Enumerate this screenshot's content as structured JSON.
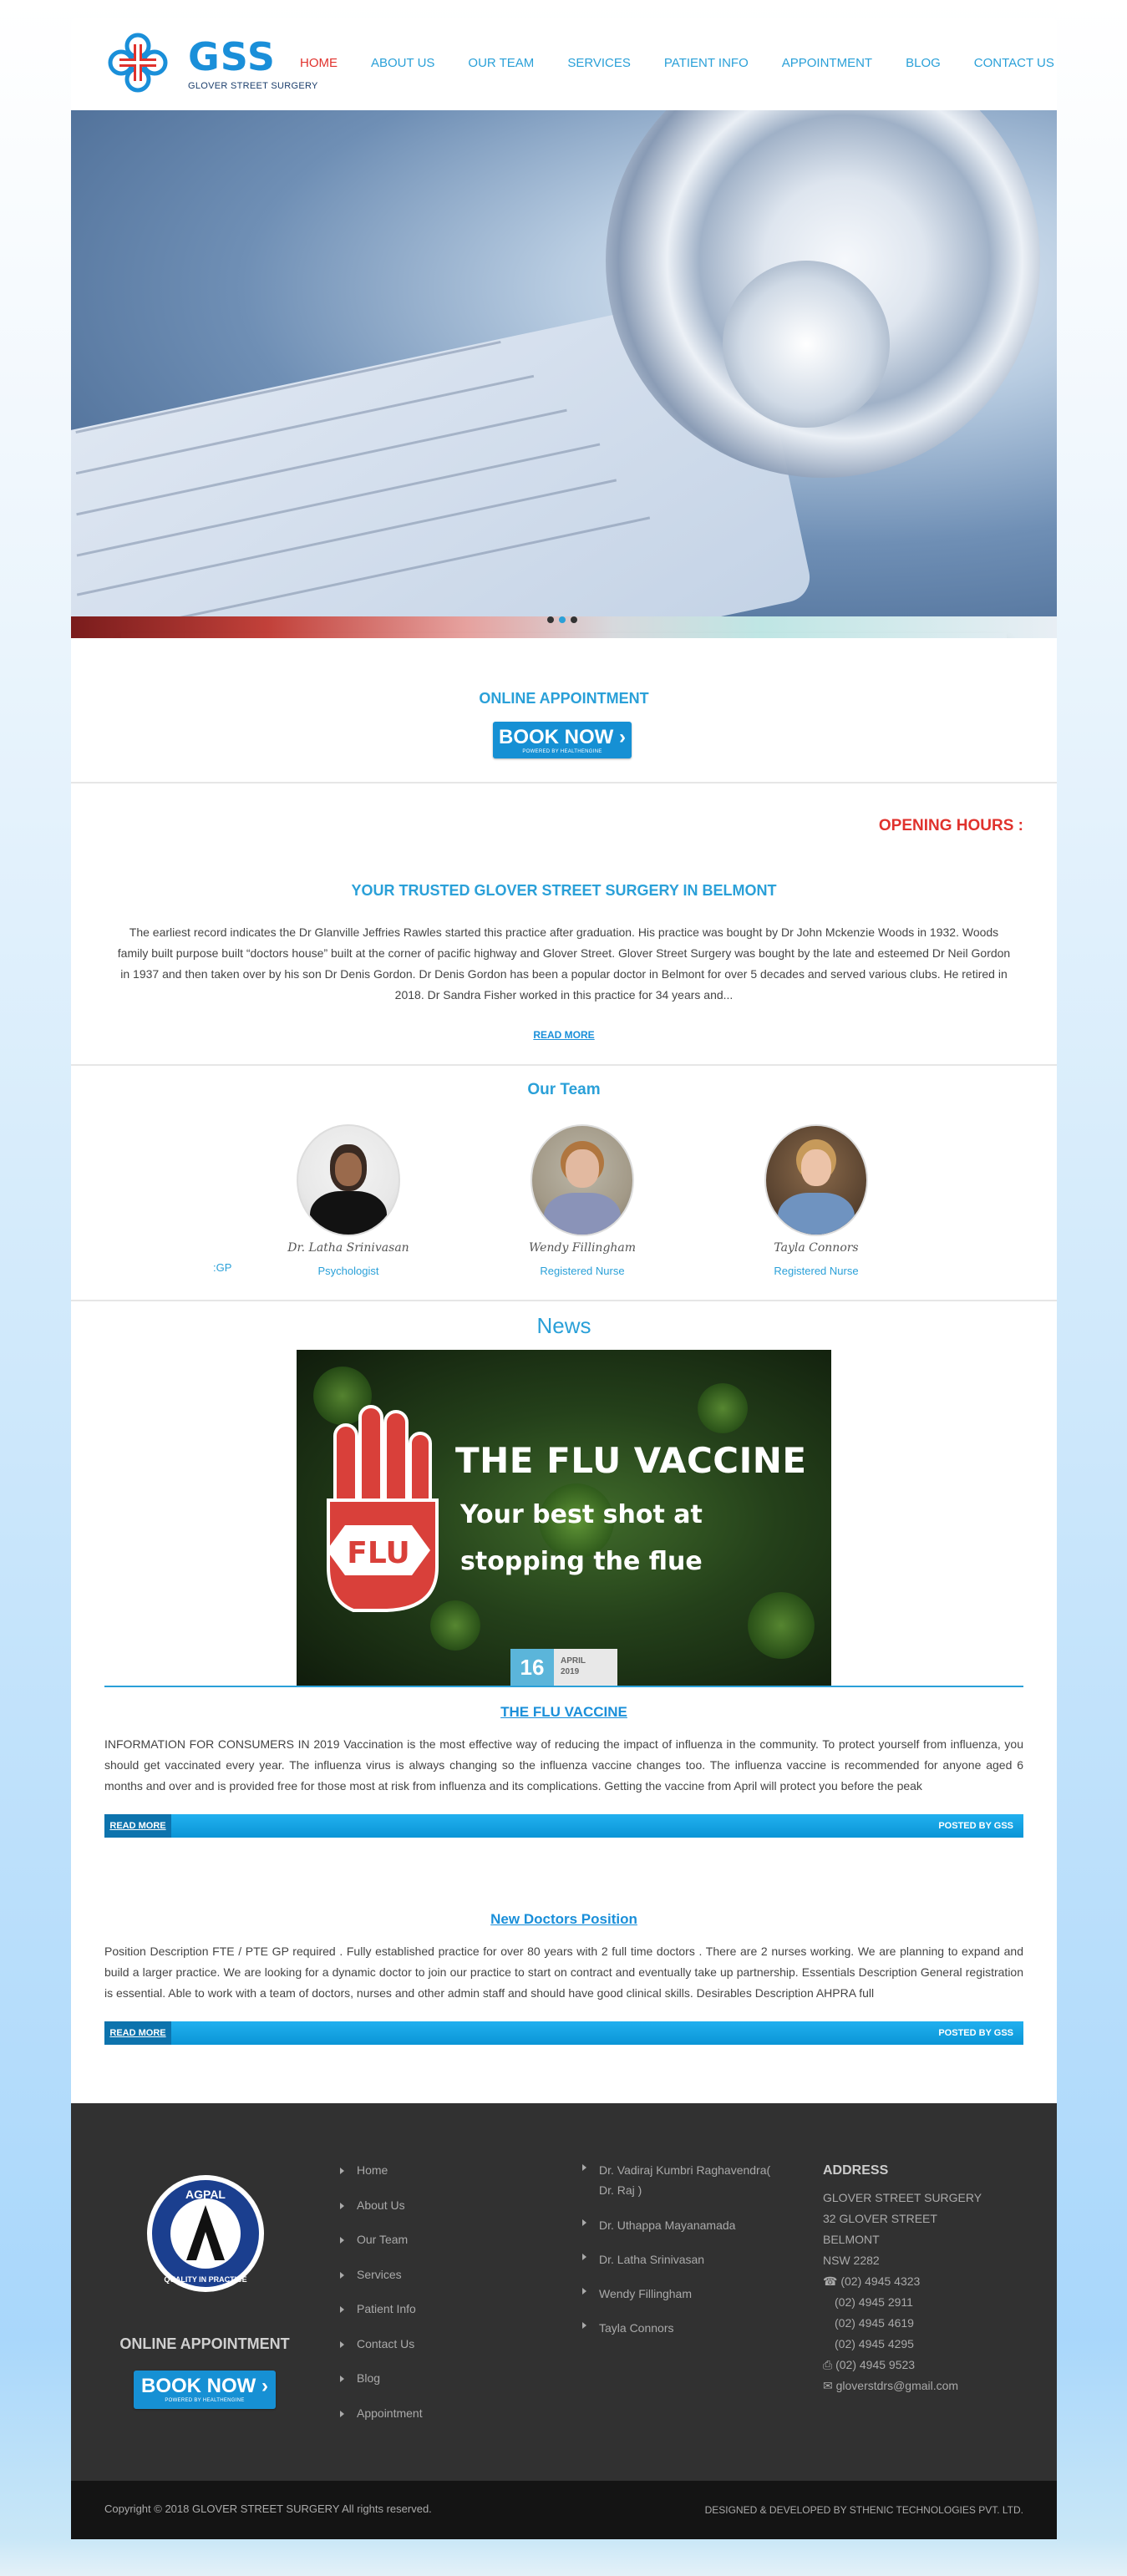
{
  "brand": {
    "logo_text": "GSS",
    "logo_subtitle": "GLOVER STREET SURGERY"
  },
  "nav": [
    {
      "label": "HOME",
      "active": true
    },
    {
      "label": "ABOUT US"
    },
    {
      "label": "OUR TEAM"
    },
    {
      "label": "SERVICES"
    },
    {
      "label": "PATIENT INFO"
    },
    {
      "label": "APPOINTMENT"
    },
    {
      "label": "BLOG"
    },
    {
      "label": "CONTACT US"
    }
  ],
  "hero": {
    "slides": 3,
    "active_slide": 2
  },
  "appointment": {
    "title": "ONLINE APPOINTMENT",
    "button": "BOOK NOW",
    "powered": "POWERED BY HEALTHENGINE"
  },
  "about": {
    "hours_label": "OPENING HOURS :",
    "title": "YOUR TRUSTED GLOVER STREET SURGERY IN BELMONT",
    "text": "The earliest record indicates the Dr Glanville Jeffries Rawles started this practice after graduation. His practice was bought by Dr John Mckenzie Woods in 1932. Woods family built purpose built “doctors house” built at the corner of pacific highway and Glover Street. Glover Street Surgery was bought by the late and esteemed Dr Neil Gordon in 1937 and then taken over by his son Dr Denis Gordon. Dr Denis Gordon has been a popular doctor in Belmont for over 5 decades and served various clubs. He retired in 2018. Dr Sandra Fisher worked in this practice for 34 years and...",
    "read_more": "READ MORE"
  },
  "team": {
    "title": "Our Team",
    "partial_role": ":GP",
    "members": [
      {
        "name": "Dr. Latha Srinivasan",
        "role": "Psychologist"
      },
      {
        "name": "Wendy Fillingham",
        "role": "Registered Nurse"
      },
      {
        "name": "Tayla Connors",
        "role": "Registered Nurse"
      }
    ]
  },
  "news": {
    "title": "News",
    "image": {
      "line1": "THE FLU VACCINE",
      "line2": "Your best shot at",
      "line3": "stopping the flue",
      "sign": "FLU"
    },
    "date": {
      "day": "16",
      "month": "APRIL",
      "year": "2019"
    },
    "posts": [
      {
        "title": "THE FLU VACCINE",
        "text": "INFORMATION FOR CONSUMERS IN 2019 Vaccination is the most effective way of reducing the impact of influenza in the community. To protect yourself from influenza, you should get vaccinated every year. The influenza virus is always changing so the influenza vaccine changes too. The influenza vaccine is recommended for anyone aged 6 months and over and is provided free for those most at risk from influenza and its complications. Getting the vaccine from April will protect you before the peak",
        "read_more": "READ MORE",
        "posted_by": "POSTED BY GSS"
      },
      {
        "title": "New Doctors Position",
        "text": "Position Description FTE / PTE GP required . Fully established practice for over 80 years with 2 full time doctors . There are 2 nurses working. We are planning to expand and build a larger practice. We are looking for a dynamic doctor to join our practice to start on contract and eventually take up partnership. Essentials Description General registration is essential. Able to work with a team of doctors, nurses and other admin staff and should have good clinical skills. Desirables Description AHPRA full",
        "read_more": "READ MORE",
        "posted_by": "POSTED BY GSS"
      }
    ]
  },
  "footer": {
    "agpal_top": "AGPAL",
    "agpal_bottom": "QUALITY IN PRACTICE",
    "appointment_title": "ONLINE APPOINTMENT",
    "book_button": "BOOK NOW",
    "powered": "POWERED BY HEALTHENGINE",
    "links": [
      "Home",
      "About Us",
      "Our Team",
      "Services",
      "Patient Info",
      "Contact Us",
      "Blog",
      "Appointment"
    ],
    "doctors": [
      "Dr. Vadiraj Kumbri Raghavendra( Dr. Raj )",
      "Dr. Uthappa Mayanamada",
      "Dr. Latha Srinivasan",
      "Wendy Fillingham",
      "Tayla Connors"
    ],
    "address": {
      "heading": "ADDRESS",
      "lines": [
        "GLOVER STREET SURGERY",
        "32 GLOVER STREET",
        "BELMONT",
        "NSW 2282"
      ],
      "phones": [
        "(02) 4945 4323",
        "(02) 4945 2911",
        "(02) 4945 4619",
        "(02) 4945 4295"
      ],
      "fax": "(02) 4945 9523",
      "email": "gloverstdrs@gmail.com"
    },
    "copyright": "Copyright © 2018 GLOVER STREET SURGERY   All rights reserved.",
    "developer": "DESIGNED & DEVELOPED BY STHENIC TECHNOLOGIES PVT. LTD."
  },
  "colors": {
    "accent": "#2aa0d8",
    "active_nav": "#e0322d",
    "button": "#1690d4",
    "footer_bg": "#313131"
  }
}
